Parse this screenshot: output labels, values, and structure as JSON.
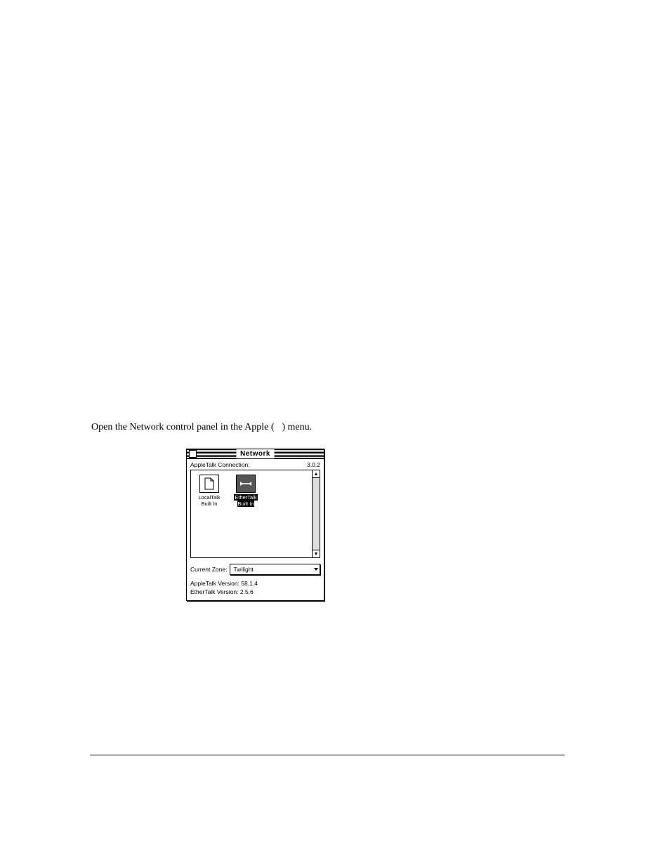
{
  "doc": {
    "menu_instruction_prefix": "Open the Network control panel in the Apple (",
    "menu_instruction_suffix": ") menu."
  },
  "window": {
    "title": "Network",
    "label": "AppleTalk Connection:",
    "version_badge": "3.0.2",
    "icons": {
      "localtalk": {
        "line1": "LocalTalk",
        "line2": "Built In"
      },
      "ethertalk": {
        "line1": "EtherTalk",
        "line2": "Built In"
      }
    },
    "zone_label": "Current Zone:",
    "zone_value": "Twilight",
    "appletalk_version": "AppleTalk Version: 58.1.4",
    "ethertalk_version": "EtherTalk Version: 2.5.6"
  }
}
